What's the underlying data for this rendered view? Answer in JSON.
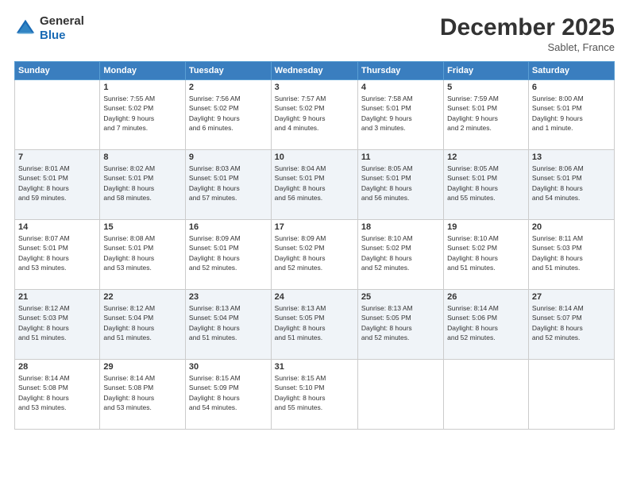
{
  "header": {
    "logo_line1": "General",
    "logo_line2": "Blue",
    "month": "December 2025",
    "location": "Sablet, France"
  },
  "weekdays": [
    "Sunday",
    "Monday",
    "Tuesday",
    "Wednesday",
    "Thursday",
    "Friday",
    "Saturday"
  ],
  "weeks": [
    [
      {
        "day": "",
        "info": ""
      },
      {
        "day": "1",
        "info": "Sunrise: 7:55 AM\nSunset: 5:02 PM\nDaylight: 9 hours\nand 7 minutes."
      },
      {
        "day": "2",
        "info": "Sunrise: 7:56 AM\nSunset: 5:02 PM\nDaylight: 9 hours\nand 6 minutes."
      },
      {
        "day": "3",
        "info": "Sunrise: 7:57 AM\nSunset: 5:02 PM\nDaylight: 9 hours\nand 4 minutes."
      },
      {
        "day": "4",
        "info": "Sunrise: 7:58 AM\nSunset: 5:01 PM\nDaylight: 9 hours\nand 3 minutes."
      },
      {
        "day": "5",
        "info": "Sunrise: 7:59 AM\nSunset: 5:01 PM\nDaylight: 9 hours\nand 2 minutes."
      },
      {
        "day": "6",
        "info": "Sunrise: 8:00 AM\nSunset: 5:01 PM\nDaylight: 9 hours\nand 1 minute."
      }
    ],
    [
      {
        "day": "7",
        "info": "Sunrise: 8:01 AM\nSunset: 5:01 PM\nDaylight: 8 hours\nand 59 minutes."
      },
      {
        "day": "8",
        "info": "Sunrise: 8:02 AM\nSunset: 5:01 PM\nDaylight: 8 hours\nand 58 minutes."
      },
      {
        "day": "9",
        "info": "Sunrise: 8:03 AM\nSunset: 5:01 PM\nDaylight: 8 hours\nand 57 minutes."
      },
      {
        "day": "10",
        "info": "Sunrise: 8:04 AM\nSunset: 5:01 PM\nDaylight: 8 hours\nand 56 minutes."
      },
      {
        "day": "11",
        "info": "Sunrise: 8:05 AM\nSunset: 5:01 PM\nDaylight: 8 hours\nand 56 minutes."
      },
      {
        "day": "12",
        "info": "Sunrise: 8:05 AM\nSunset: 5:01 PM\nDaylight: 8 hours\nand 55 minutes."
      },
      {
        "day": "13",
        "info": "Sunrise: 8:06 AM\nSunset: 5:01 PM\nDaylight: 8 hours\nand 54 minutes."
      }
    ],
    [
      {
        "day": "14",
        "info": "Sunrise: 8:07 AM\nSunset: 5:01 PM\nDaylight: 8 hours\nand 53 minutes."
      },
      {
        "day": "15",
        "info": "Sunrise: 8:08 AM\nSunset: 5:01 PM\nDaylight: 8 hours\nand 53 minutes."
      },
      {
        "day": "16",
        "info": "Sunrise: 8:09 AM\nSunset: 5:01 PM\nDaylight: 8 hours\nand 52 minutes."
      },
      {
        "day": "17",
        "info": "Sunrise: 8:09 AM\nSunset: 5:02 PM\nDaylight: 8 hours\nand 52 minutes."
      },
      {
        "day": "18",
        "info": "Sunrise: 8:10 AM\nSunset: 5:02 PM\nDaylight: 8 hours\nand 52 minutes."
      },
      {
        "day": "19",
        "info": "Sunrise: 8:10 AM\nSunset: 5:02 PM\nDaylight: 8 hours\nand 51 minutes."
      },
      {
        "day": "20",
        "info": "Sunrise: 8:11 AM\nSunset: 5:03 PM\nDaylight: 8 hours\nand 51 minutes."
      }
    ],
    [
      {
        "day": "21",
        "info": "Sunrise: 8:12 AM\nSunset: 5:03 PM\nDaylight: 8 hours\nand 51 minutes."
      },
      {
        "day": "22",
        "info": "Sunrise: 8:12 AM\nSunset: 5:04 PM\nDaylight: 8 hours\nand 51 minutes."
      },
      {
        "day": "23",
        "info": "Sunrise: 8:13 AM\nSunset: 5:04 PM\nDaylight: 8 hours\nand 51 minutes."
      },
      {
        "day": "24",
        "info": "Sunrise: 8:13 AM\nSunset: 5:05 PM\nDaylight: 8 hours\nand 51 minutes."
      },
      {
        "day": "25",
        "info": "Sunrise: 8:13 AM\nSunset: 5:05 PM\nDaylight: 8 hours\nand 52 minutes."
      },
      {
        "day": "26",
        "info": "Sunrise: 8:14 AM\nSunset: 5:06 PM\nDaylight: 8 hours\nand 52 minutes."
      },
      {
        "day": "27",
        "info": "Sunrise: 8:14 AM\nSunset: 5:07 PM\nDaylight: 8 hours\nand 52 minutes."
      }
    ],
    [
      {
        "day": "28",
        "info": "Sunrise: 8:14 AM\nSunset: 5:08 PM\nDaylight: 8 hours\nand 53 minutes."
      },
      {
        "day": "29",
        "info": "Sunrise: 8:14 AM\nSunset: 5:08 PM\nDaylight: 8 hours\nand 53 minutes."
      },
      {
        "day": "30",
        "info": "Sunrise: 8:15 AM\nSunset: 5:09 PM\nDaylight: 8 hours\nand 54 minutes."
      },
      {
        "day": "31",
        "info": "Sunrise: 8:15 AM\nSunset: 5:10 PM\nDaylight: 8 hours\nand 55 minutes."
      },
      {
        "day": "",
        "info": ""
      },
      {
        "day": "",
        "info": ""
      },
      {
        "day": "",
        "info": ""
      }
    ]
  ]
}
